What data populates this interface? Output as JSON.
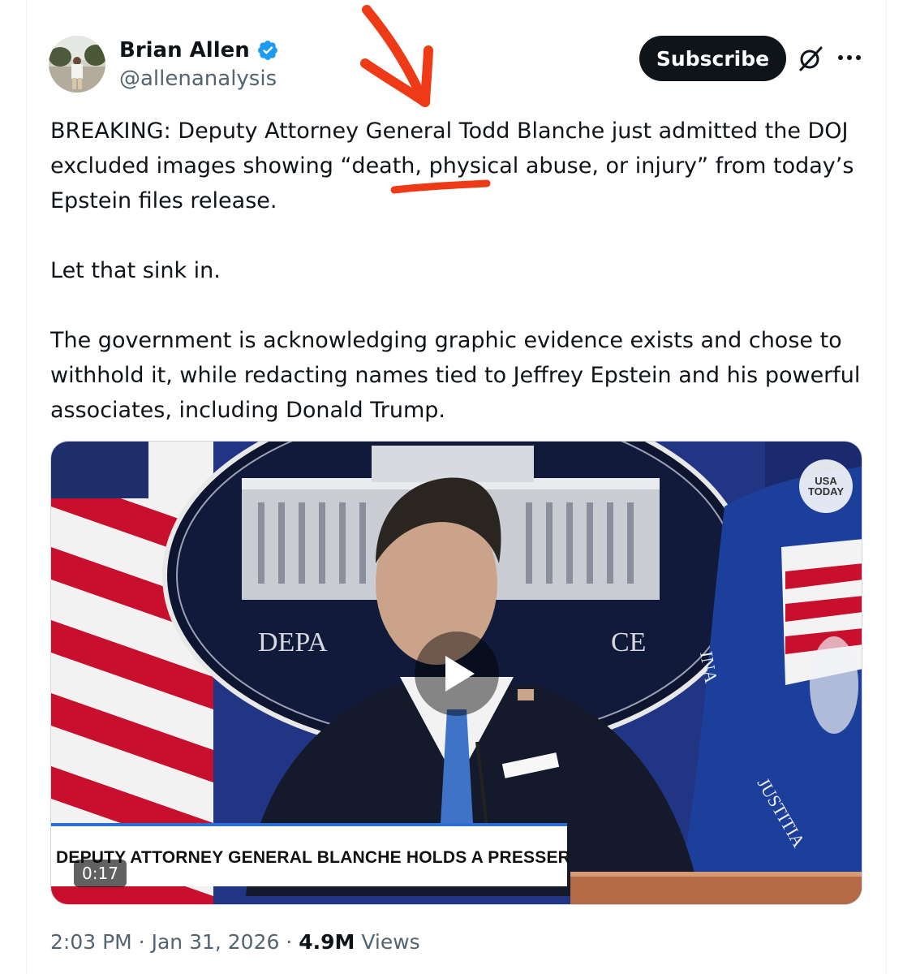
{
  "author": {
    "name": "Brian Allen",
    "handle": "@allenanalysis"
  },
  "header": {
    "subscribe_label": "Subscribe"
  },
  "tweet": {
    "paragraph_1_before": "BREAKING: Deputy Attorney General Todd Blanche just admitted the DOJ excluded images showing ",
    "paragraph_1_highlight": "“death,",
    "paragraph_1_after": " physical abuse, or injury” from today’s Epstein files release.",
    "paragraph_2": "Let that sink in.",
    "paragraph_3": "The government is acknowledging graphic evidence exists and chose to withhold it, while redacting names tied to Jeffrey Epstein and his powerful associates, including Donald Trump."
  },
  "media": {
    "caption": "DEPUTY ATTORNEY GENERAL BLANCHE HOLDS A PRESSER",
    "duration": "0:17",
    "badge_line_1": "USA",
    "badge_line_2": "TODAY",
    "seal_text": "DEPA",
    "seal_text_right": "CE",
    "flag_text": "JUSTITIA",
    "flag_text_2": "INA"
  },
  "meta": {
    "time": "2:03 PM",
    "separator": " · ",
    "date": "Jan 31, 2026",
    "views_count": "4.9M",
    "views_label": "Views"
  },
  "colors": {
    "annotation_red": "#ee3a16",
    "verified_blue": "#1d9bf0",
    "text_primary": "#0f1419",
    "text_secondary": "#536471"
  },
  "icons": {
    "verified": "verified-badge-icon",
    "grok": "grok-slash-icon",
    "more": "more-dots-icon",
    "play": "play-icon"
  }
}
